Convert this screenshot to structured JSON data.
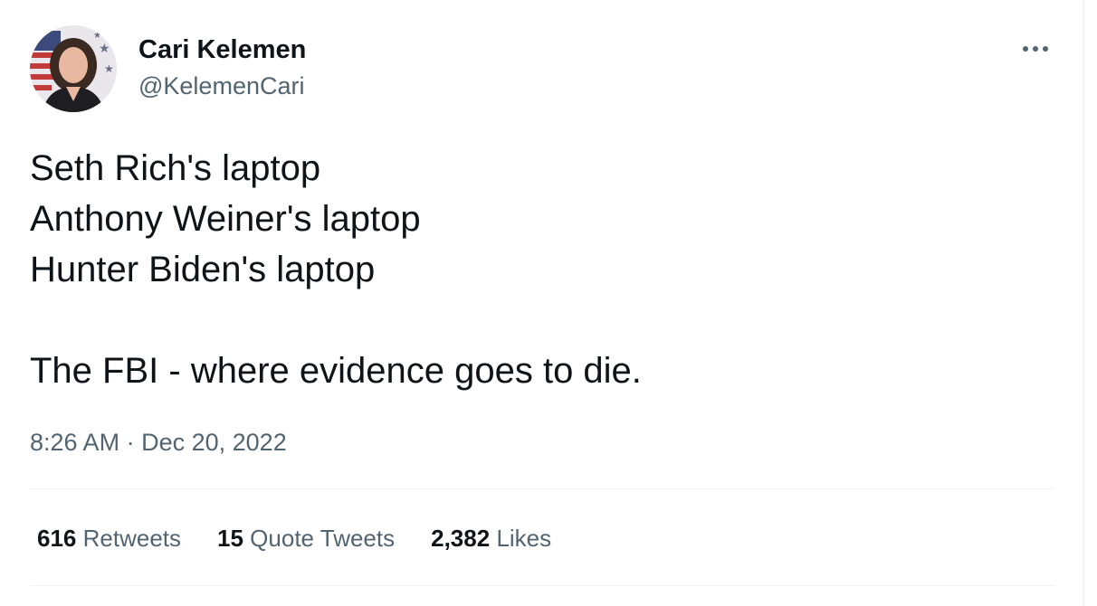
{
  "author": {
    "display_name": "Cari Kelemen",
    "handle": "@KelemenCari",
    "avatar_icon": "profile-photo"
  },
  "tweet": {
    "lines": [
      "Seth Rich's laptop",
      "Anthony Weiner's laptop",
      "Hunter Biden's laptop",
      "",
      "The FBI - where evidence goes to die."
    ],
    "time": "8:26 AM",
    "separator": "·",
    "date": "Dec 20, 2022"
  },
  "stats": {
    "retweets": {
      "count": "616",
      "label": "Retweets"
    },
    "quotes": {
      "count": "15",
      "label": "Quote Tweets"
    },
    "likes": {
      "count": "2,382",
      "label": "Likes"
    }
  },
  "icons": {
    "more": "more-horizontal-icon"
  },
  "colors": {
    "text_primary": "#0f1419",
    "text_secondary": "#536471",
    "divider": "#eff3f4"
  }
}
